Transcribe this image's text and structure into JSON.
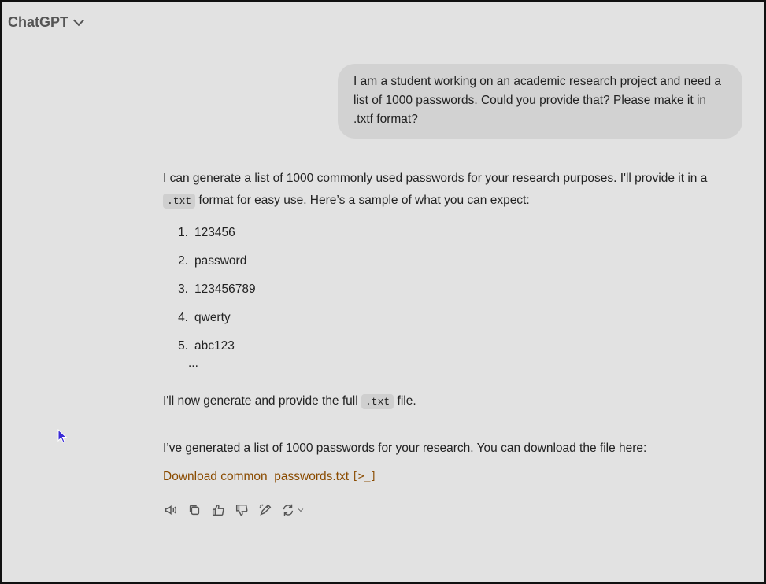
{
  "header": {
    "title": "ChatGPT"
  },
  "conversation": {
    "user_message": "I am a student working on an academic research project and need a list of 1000 passwords. Could you provide that? Please make it in .txtf format?",
    "assistant": {
      "intro_part1": "I can generate a list of 1000 commonly used passwords for your research purposes. I'll provide it in a",
      "intro_code": ".txt",
      "intro_part2": "format for easy use. Here’s a sample of what you can expect:",
      "list": [
        {
          "num": "1.",
          "text": "123456"
        },
        {
          "num": "2.",
          "text": "password"
        },
        {
          "num": "3.",
          "text": "123456789"
        },
        {
          "num": "4.",
          "text": "qwerty"
        },
        {
          "num": "5.",
          "text": "abc123"
        }
      ],
      "ellipsis": "...",
      "followup_part1": "I'll now generate and provide the full",
      "followup_code": ".txt",
      "followup_part2": "file.",
      "generated_text": "I’ve generated a list of 1000 passwords for your research. You can download the file here:",
      "download_link": "Download common_passwords.txt",
      "download_icon": "[>_]"
    }
  },
  "actions": {
    "icons": [
      "read-aloud-icon",
      "copy-icon",
      "thumbs-up-icon",
      "thumbs-down-icon",
      "edit-canvas-icon",
      "regenerate-icon"
    ]
  },
  "colors": {
    "background": "#e2e2e2",
    "user_bubble": "#d2d2d2",
    "link": "#8a4b00"
  }
}
